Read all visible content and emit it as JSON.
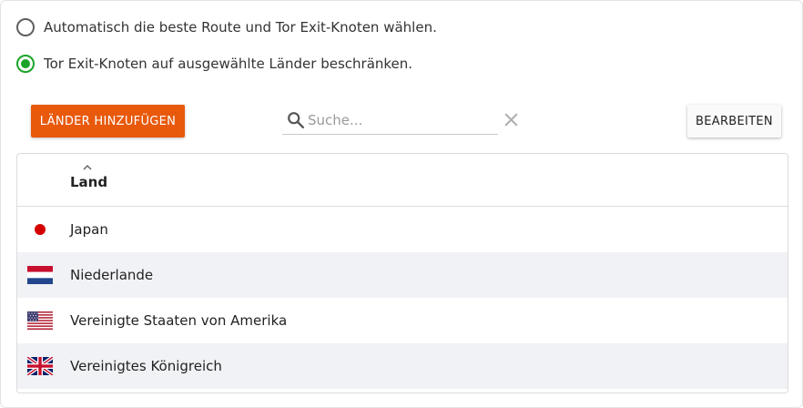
{
  "options": {
    "auto_label": "Automatisch die beste Route und Tor Exit-Knoten wählen.",
    "restrict_label": "Tor Exit-Knoten auf ausgewählte Länder beschränken.",
    "selected": "restrict"
  },
  "toolbar": {
    "add_label": "LÄNDER HINZUFÜGEN",
    "search_placeholder": "Suche...",
    "search_value": "",
    "edit_label": "BEARBEITEN"
  },
  "table": {
    "column_header": "Land",
    "sort": "ascending",
    "rows": [
      {
        "name": "Japan",
        "flag": "flag-japan-icon"
      },
      {
        "name": "Niederlande",
        "flag": "flag-netherlands-icon"
      },
      {
        "name": "Vereinigte Staaten von Amerika",
        "flag": "flag-usa-icon"
      },
      {
        "name": "Vereinigtes Königreich",
        "flag": "flag-uk-icon"
      }
    ]
  },
  "colors": {
    "accent": "#e8590c",
    "radio_selected": "#1aa52a",
    "row_alt": "#f1f2f5"
  }
}
